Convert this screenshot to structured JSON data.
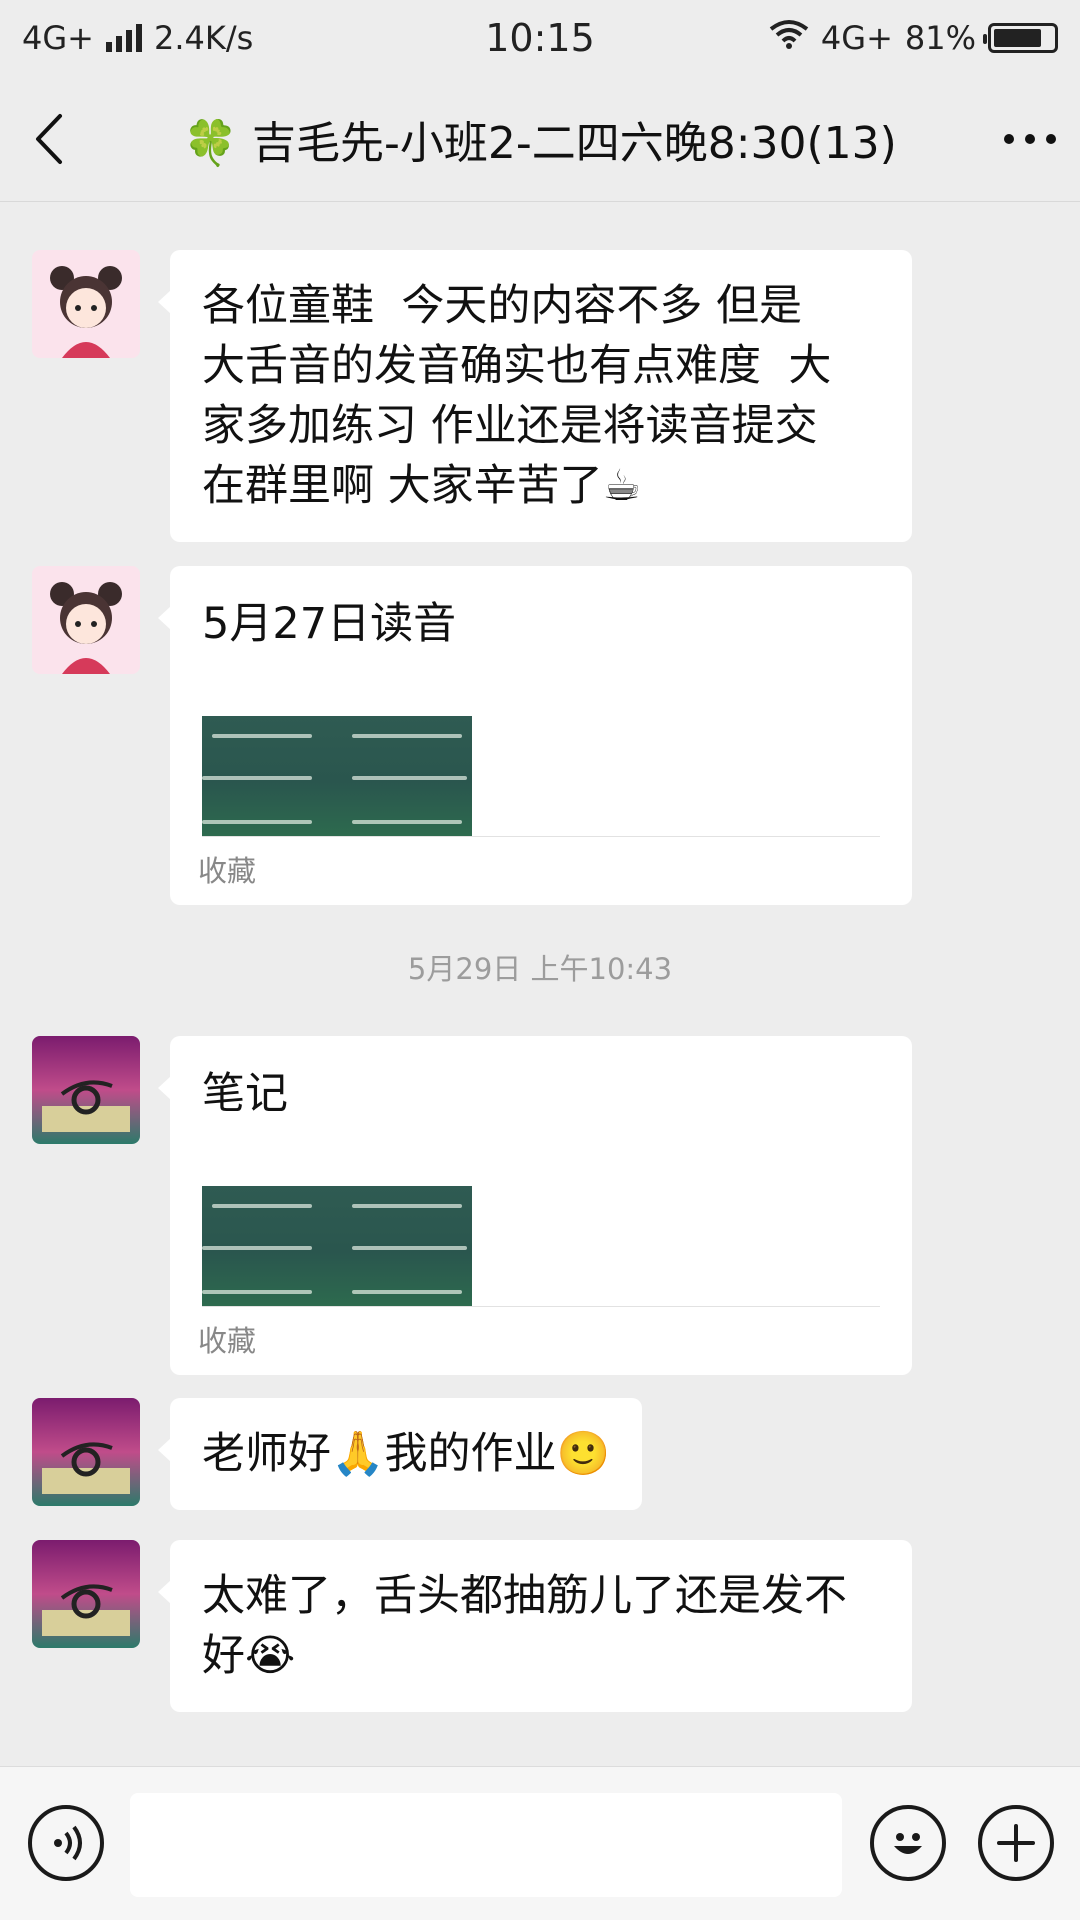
{
  "status_bar": {
    "network_left": "4G+",
    "speed": "2.4K/s",
    "time": "10:15",
    "network_right": "4G+",
    "battery": "81%",
    "battery_level": 0.81
  },
  "header": {
    "title_emoji": "🍀",
    "title": "吉毛先-小班2-二四六晚8:30(13)",
    "back_icon": "chevron-left-icon",
    "more_icon": "more-dots-icon"
  },
  "messages": [
    {
      "type": "text",
      "lines": [
        "各位童鞋  今天的内容不多 但是",
        "大舌音的发音确实也有点难度  大",
        "家多加练习 作业还是将读音提交",
        "在群里啊 大家辛苦了☕"
      ]
    },
    {
      "type": "card",
      "title": "5月27日读音",
      "footer": "收藏"
    },
    {
      "type": "time",
      "text": "5月29日 上午10:43"
    },
    {
      "type": "card",
      "title": "笔记",
      "footer": "收藏"
    },
    {
      "type": "text",
      "text": "老师好🙏我的作业🙂"
    },
    {
      "type": "text",
      "lines": [
        "太难了，舌头都抽筋儿了还是发不",
        "好😭"
      ]
    }
  ],
  "input_bar": {
    "voice_icon": "voice-icon",
    "emoji_icon": "smiley-icon",
    "plus_icon": "plus-icon",
    "value": ""
  }
}
